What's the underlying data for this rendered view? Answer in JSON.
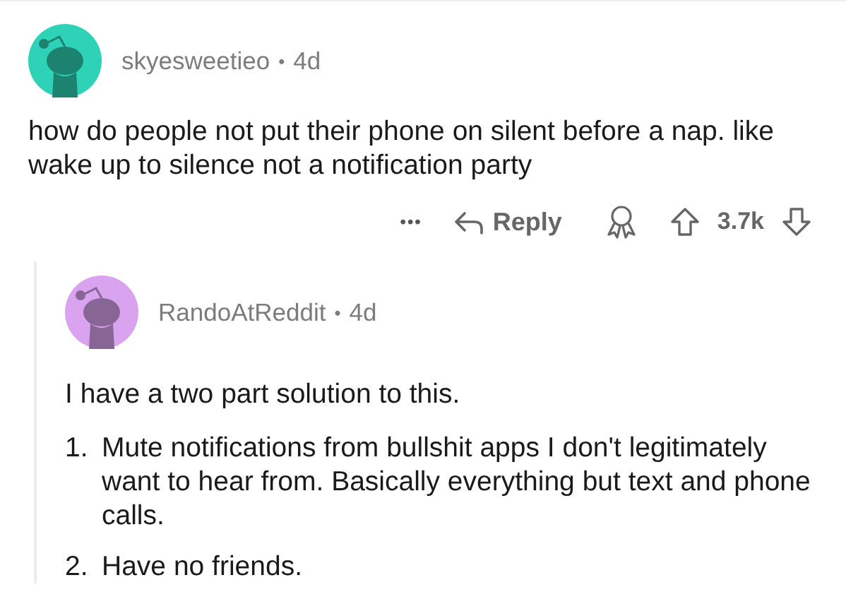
{
  "comments": [
    {
      "author": "skyesweetieo",
      "separator": "•",
      "time": "4d",
      "color": "#2ed3b7",
      "body": "how do people not put their phone on silent before a nap. like wake up to silence not a notification party",
      "actions": {
        "more": "•••",
        "reply": "Reply",
        "score": "3.7k"
      },
      "children": [
        {
          "author": "RandoAtReddit",
          "separator": "•",
          "time": "4d",
          "color": "#d9a3ef",
          "body": "I have a two part solution to this.",
          "list": [
            {
              "number": "1.",
              "text": "Mute notifications from bullshit apps I don't legitimately want to hear from.  Basically everything but text and phone calls."
            },
            {
              "number": "2.",
              "text": "Have no friends."
            }
          ]
        }
      ]
    }
  ]
}
